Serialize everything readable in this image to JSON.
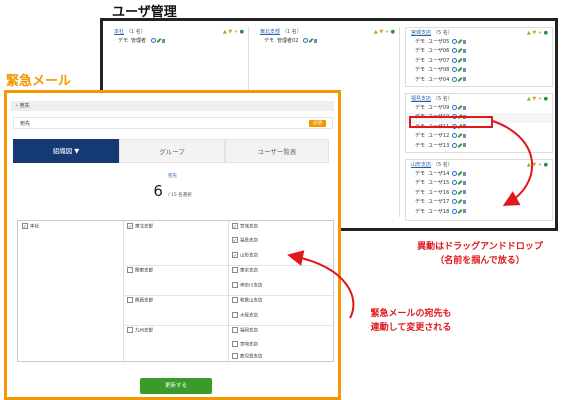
{
  "user_mgmt": {
    "title": "ユーザ管理",
    "columns": [
      {
        "cards": [
          {
            "name": "本社",
            "count": "（1 名）",
            "users": [
              [
                "デモ",
                "管理者"
              ]
            ]
          }
        ]
      },
      {
        "cards": [
          {
            "name": "東北支部",
            "count": "（1 名）",
            "users": [
              [
                "デモ",
                "管理者02"
              ]
            ]
          }
        ]
      },
      {
        "cards": [
          {
            "name": "宮城支店",
            "count": "（5 名）",
            "users": [
              [
                "デモ",
                "ユーザ05"
              ],
              [
                "デモ",
                "ユーザ06"
              ],
              [
                "デモ",
                "ユーザ07"
              ],
              [
                "デモ",
                "ユーザ08"
              ],
              [
                "デモ",
                "ユーザ04"
              ]
            ]
          },
          {
            "name": "福島支店",
            "count": "（5 名）",
            "users": [
              [
                "デモ",
                "ユーザ09"
              ],
              [
                "デモ",
                "ユーザ10"
              ],
              [
                "デモ",
                "ユーザ11"
              ],
              [
                "デモ",
                "ユーザ12"
              ],
              [
                "デモ",
                "ユーザ13"
              ]
            ]
          },
          {
            "name": "山形支店",
            "count": "（5 名）",
            "users": [
              [
                "デモ",
                "ユーザ14"
              ],
              [
                "デモ",
                "ユーザ15"
              ],
              [
                "デモ",
                "ユーザ16"
              ],
              [
                "デモ",
                "ユーザ17"
              ],
              [
                "デモ",
                "ユーザ18"
              ]
            ]
          }
        ]
      }
    ]
  },
  "emergency_mail": {
    "title": "緊急メール",
    "breadcrumb": "宛先",
    "section_label": "宛先",
    "badge": "必須",
    "tabs": [
      {
        "label": "組織図 ▼",
        "active": true
      },
      {
        "label": "グループ",
        "active": false
      },
      {
        "label": "ユーザー覧表",
        "active": false
      }
    ],
    "selected_label": "宛先",
    "selected_count": "6",
    "selected_total": "/ 15 名選択",
    "tree": {
      "col1": [
        {
          "label": "本社",
          "checked": true
        }
      ],
      "col2": [
        {
          "label": "東北支部",
          "checked": true
        },
        {
          "label": "関東支部",
          "checked": false
        },
        {
          "label": "関西支部",
          "checked": false
        },
        {
          "label": "九州支部",
          "checked": false
        }
      ],
      "col3": [
        {
          "label": "宮城支店",
          "checked": true
        },
        {
          "label": "福島支店",
          "checked": true
        },
        {
          "label": "山形支店",
          "checked": true
        },
        {
          "label": "東京支店",
          "checked": false
        },
        {
          "label": "神奈川支店",
          "checked": false
        },
        {
          "label": "和歌山支店",
          "checked": false
        },
        {
          "label": "大阪支店",
          "checked": false
        },
        {
          "label": "福岡支店",
          "checked": false
        },
        {
          "label": "宮崎支店",
          "checked": false
        },
        {
          "label": "鹿児島支店",
          "checked": false
        }
      ]
    },
    "update_button": "更新する"
  },
  "annotations": {
    "drag_note_1": "異動はドラッグアンドドロップ",
    "drag_note_2": "（名前を掴んで放る）",
    "mail_note_1": "緊急メールの宛先も",
    "mail_note_2": "連動して変更される"
  },
  "colors": {
    "accent": "#f39800",
    "navy": "#153a73",
    "red": "#e0181c",
    "green": "#3a9a2a"
  }
}
